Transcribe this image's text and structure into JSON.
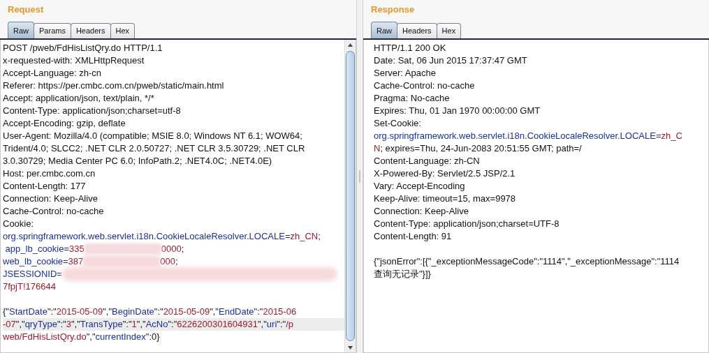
{
  "panels": [
    {
      "title": "Request",
      "tabs": [
        {
          "label": "Raw",
          "selected": true
        },
        {
          "label": "Params",
          "selected": false
        },
        {
          "label": "Headers",
          "selected": false
        },
        {
          "label": "Hex",
          "selected": false
        }
      ],
      "scrollbar": true,
      "lines": [
        {
          "highlighted": false,
          "parts": [
            {
              "t": "POST /pweb/FdHisListQry.do HTTP/1.1",
              "kind": "plain"
            }
          ]
        },
        {
          "highlighted": false,
          "parts": [
            {
              "t": "x-requested-with: XMLHttpRequest",
              "kind": "plain"
            }
          ]
        },
        {
          "highlighted": false,
          "parts": [
            {
              "t": "Accept-Language: zh-cn",
              "kind": "plain"
            }
          ]
        },
        {
          "highlighted": false,
          "parts": [
            {
              "t": "Referer: https://per.cmbc.com.cn/pweb/static/main.html",
              "kind": "plain"
            }
          ]
        },
        {
          "highlighted": false,
          "parts": [
            {
              "t": "Accept: application/json, text/plain, */*",
              "kind": "plain"
            }
          ]
        },
        {
          "highlighted": false,
          "parts": [
            {
              "t": "Content-Type: application/json;charset=utf-8",
              "kind": "plain"
            }
          ]
        },
        {
          "highlighted": false,
          "parts": [
            {
              "t": "Accept-Encoding: gzip, deflate",
              "kind": "plain"
            }
          ]
        },
        {
          "highlighted": false,
          "parts": [
            {
              "t": "User-Agent: Mozilla/4.0 (compatible; MSIE 8.0; Windows NT 6.1; WOW64;",
              "kind": "plain"
            }
          ]
        },
        {
          "highlighted": false,
          "parts": [
            {
              "t": "Trident/4.0; SLCC2; .NET CLR 2.0.50727; .NET CLR 3.5.30729; .NET CLR",
              "kind": "plain"
            }
          ]
        },
        {
          "highlighted": false,
          "parts": [
            {
              "t": "3.0.30729; Media Center PC 6.0; InfoPath.2; .NET4.0C; .NET4.0E)",
              "kind": "plain"
            }
          ]
        },
        {
          "highlighted": false,
          "parts": [
            {
              "t": "Host: per.cmbc.com.cn",
              "kind": "plain"
            }
          ]
        },
        {
          "highlighted": false,
          "parts": [
            {
              "t": "Content-Length: 177",
              "kind": "plain"
            }
          ]
        },
        {
          "highlighted": false,
          "parts": [
            {
              "t": "Connection: Keep-Alive",
              "kind": "plain"
            }
          ]
        },
        {
          "highlighted": false,
          "parts": [
            {
              "t": "Cache-Control: no-cache",
              "kind": "plain"
            }
          ]
        },
        {
          "highlighted": false,
          "parts": [
            {
              "t": "Cookie:",
              "kind": "plain"
            }
          ]
        },
        {
          "highlighted": false,
          "parts": [
            {
              "t": "org.springframework.web.servlet.i18n.CookieLocaleResolver.LOCALE=",
              "kind": "name"
            },
            {
              "t": "zh_CN",
              "kind": "value"
            },
            {
              "t": ";",
              "kind": "plain"
            }
          ]
        },
        {
          "highlighted": false,
          "parts": [
            {
              "t": " app_lb_cookie=",
              "kind": "name"
            },
            {
              "t": "335",
              "kind": "value"
            },
            {
              "kind": "blur"
            },
            {
              "t": "0000",
              "kind": "value"
            },
            {
              "t": ";",
              "kind": "plain"
            }
          ]
        },
        {
          "highlighted": false,
          "parts": [
            {
              "t": "web_lb_cookie=",
              "kind": "name"
            },
            {
              "t": "387",
              "kind": "value"
            },
            {
              "kind": "blur"
            },
            {
              "t": "000",
              "kind": "value"
            },
            {
              "t": ";",
              "kind": "plain"
            }
          ]
        },
        {
          "highlighted": false,
          "parts": [
            {
              "t": "JSESSIONID=",
              "kind": "name"
            },
            {
              "kind": "blur_wide"
            }
          ]
        },
        {
          "highlighted": false,
          "parts": [
            {
              "t": "7fpjT!176644",
              "kind": "value"
            }
          ]
        },
        {
          "highlighted": false
        },
        {
          "highlighted": false,
          "parts": [
            {
              "t": "{\"",
              "kind": "plain"
            },
            {
              "t": "StartDate",
              "kind": "name"
            },
            {
              "t": "\":\"",
              "kind": "plain"
            },
            {
              "t": "2015-05-09",
              "kind": "value"
            },
            {
              "t": "\",\"",
              "kind": "plain"
            },
            {
              "t": "BeginDate",
              "kind": "name"
            },
            {
              "t": "\":\"",
              "kind": "plain"
            },
            {
              "t": "2015-05-09",
              "kind": "value"
            },
            {
              "t": "\",\"",
              "kind": "plain"
            },
            {
              "t": "EndDate",
              "kind": "name"
            },
            {
              "t": "\":\"",
              "kind": "plain"
            },
            {
              "t": "2015-06",
              "kind": "value"
            }
          ]
        },
        {
          "highlighted": true,
          "parts": [
            {
              "t": "-07",
              "kind": "value"
            },
            {
              "t": "\",\"",
              "kind": "plain"
            },
            {
              "t": "qryType",
              "kind": "name"
            },
            {
              "t": "\":\"",
              "kind": "plain"
            },
            {
              "t": "3",
              "kind": "value"
            },
            {
              "t": "\",\"",
              "kind": "plain"
            },
            {
              "t": "TransType",
              "kind": "name"
            },
            {
              "t": "\":\"",
              "kind": "plain"
            },
            {
              "t": "1",
              "kind": "value"
            },
            {
              "t": "\",\"",
              "kind": "plain"
            },
            {
              "t": "AcNo",
              "kind": "name"
            },
            {
              "t": "\":\"",
              "kind": "plain"
            },
            {
              "t": "6226200301604931",
              "kind": "value"
            },
            {
              "t": "\",\"",
              "kind": "plain"
            },
            {
              "t": "uri",
              "kind": "name"
            },
            {
              "t": "\":\"",
              "kind": "plain"
            },
            {
              "t": "/p",
              "kind": "value"
            }
          ]
        },
        {
          "highlighted": false,
          "parts": [
            {
              "t": "web/FdHisListQry.do",
              "kind": "value"
            },
            {
              "t": "\",\"",
              "kind": "plain"
            },
            {
              "t": "currentIndex",
              "kind": "name"
            },
            {
              "t": "\":0}",
              "kind": "plain"
            }
          ]
        }
      ]
    },
    {
      "title": "Response",
      "tabs": [
        {
          "label": "Raw",
          "selected": true
        },
        {
          "label": "Headers",
          "selected": false
        },
        {
          "label": "Hex",
          "selected": false
        }
      ],
      "scrollbar": false,
      "lines": [
        {
          "highlighted": false,
          "parts": [
            {
              "t": "HTTP/1.1 200 OK",
              "kind": "plain"
            }
          ]
        },
        {
          "highlighted": false,
          "parts": [
            {
              "t": "Date: Sat, 06 Jun 2015 17:37:47 GMT",
              "kind": "plain"
            }
          ]
        },
        {
          "highlighted": false,
          "parts": [
            {
              "t": "Server: Apache",
              "kind": "plain"
            }
          ]
        },
        {
          "highlighted": false,
          "parts": [
            {
              "t": "Cache-Control: no-cache",
              "kind": "plain"
            }
          ]
        },
        {
          "highlighted": false,
          "parts": [
            {
              "t": "Pragma: No-cache",
              "kind": "plain"
            }
          ]
        },
        {
          "highlighted": false,
          "parts": [
            {
              "t": "Expires: Thu, 01 Jan 1970 00:00:00 GMT",
              "kind": "plain"
            }
          ]
        },
        {
          "highlighted": false,
          "parts": [
            {
              "t": "Set-Cookie:",
              "kind": "plain"
            }
          ]
        },
        {
          "highlighted": false,
          "parts": [
            {
              "t": "org.springframework.web.servlet.i18n.CookieLocaleResolver.LOCALE=",
              "kind": "name"
            },
            {
              "t": "zh_C",
              "kind": "value"
            }
          ]
        },
        {
          "highlighted": false,
          "parts": [
            {
              "t": "N",
              "kind": "value"
            },
            {
              "t": "; expires=Thu, 24-Jun-2083 20:51:55 GMT; path=/",
              "kind": "plain"
            }
          ]
        },
        {
          "highlighted": false,
          "parts": [
            {
              "t": "Content-Language: zh-CN",
              "kind": "plain"
            }
          ]
        },
        {
          "highlighted": false,
          "parts": [
            {
              "t": "X-Powered-By: Servlet/2.5 JSP/2.1",
              "kind": "plain"
            }
          ]
        },
        {
          "highlighted": false,
          "parts": [
            {
              "t": "Vary: Accept-Encoding",
              "kind": "plain"
            }
          ]
        },
        {
          "highlighted": false,
          "parts": [
            {
              "t": "Keep-Alive: timeout=15, max=9978",
              "kind": "plain"
            }
          ]
        },
        {
          "highlighted": false,
          "parts": [
            {
              "t": "Connection: Keep-Alive",
              "kind": "plain"
            }
          ]
        },
        {
          "highlighted": false,
          "parts": [
            {
              "t": "Content-Type: application/json;charset=UTF-8",
              "kind": "plain"
            }
          ]
        },
        {
          "highlighted": false,
          "parts": [
            {
              "t": "Content-Length: 91",
              "kind": "plain"
            }
          ]
        },
        {
          "highlighted": false
        },
        {
          "highlighted": false,
          "parts": [
            {
              "t": "{\"jsonError\":[{\"_exceptionMessageCode\":\"1114\",\"_exceptionMessage\":\"1114",
              "kind": "plain"
            }
          ]
        },
        {
          "highlighted": false,
          "parts": [
            {
              "t": "查询无记录\"}]}",
              "kind": "plain"
            }
          ]
        }
      ]
    }
  ]
}
